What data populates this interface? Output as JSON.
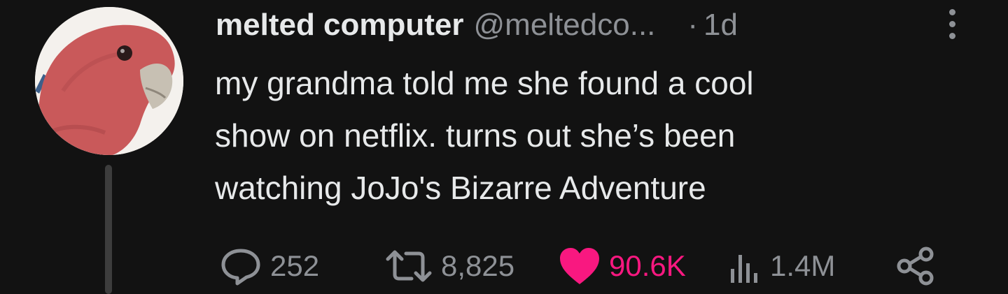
{
  "tweet": {
    "display_name": "melted computer",
    "handle": "@meltedco...",
    "separator": "·",
    "time": "1d",
    "text_lines": [
      "my grandma told me she found a cool",
      "show on netflix. turns out she’s been",
      "watching JoJo's Bizarre Adventure"
    ]
  },
  "actions": {
    "replies": "252",
    "retweets": "8,825",
    "likes": "90.6K",
    "views": "1.4M"
  },
  "icons": {
    "more": "more-vertical-icon",
    "reply": "comment-bubble-icon",
    "retweet": "retweet-icon",
    "like": "heart-icon",
    "views": "analytics-bars-icon",
    "share": "share-icon"
  },
  "colors": {
    "background": "#121212",
    "text": "#e7e9ea",
    "muted": "#8e9196",
    "like": "#f91880"
  }
}
